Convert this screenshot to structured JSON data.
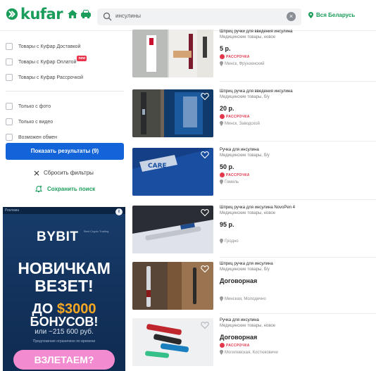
{
  "header": {
    "logo_text": "kufar",
    "search_query": "инсулины",
    "region_label": "Вся Беларусь"
  },
  "filters": {
    "items": [
      {
        "label": "Товары с Куфар Доставкой",
        "badge": ""
      },
      {
        "label": "Товары с Куфар Оплатой",
        "badge": "new"
      },
      {
        "label": "Товары с Куфар Рассрочкой",
        "badge": ""
      }
    ],
    "items2": [
      {
        "label": "Только с фото"
      },
      {
        "label": "Только с видео"
      },
      {
        "label": "Возможен обмен"
      }
    ],
    "show_button": "Показать результаты (9)",
    "reset_label": "Сбросить фильтры",
    "save_label": "Сохранить поиск"
  },
  "ad": {
    "tag": "Реклама",
    "brand": "BYBIT",
    "brand_sub": "Best Crypto Trading",
    "line1": "НОВИЧКАМ",
    "line2": "ВЕЗЕТ!",
    "line3_prefix": "ДО ",
    "line3_amount": "$3000",
    "line4": "БОНУСОВ!",
    "line5": "или ~215 600 руб.",
    "line6": "Предложение ограничено по времени",
    "cta": "ВЗЛЕТАЕМ?"
  },
  "listings": [
    {
      "title": "Шприц ручки для введения инсулина",
      "category": "Медицинские товары, новое",
      "price": "5 р.",
      "installment": "РАССРОЧКА",
      "location": "Минск, Фрунзенский"
    },
    {
      "title": "Шприц ручка для введения инсулина",
      "category": "Медицинские товары, б/у",
      "price": "20 р.",
      "installment": "РАССРОЧКА",
      "location": "Минск, Заводской"
    },
    {
      "title": "Ручка для инсулина",
      "category": "Медицинские товары, б/у",
      "price": "50 р.",
      "installment": "РАССРОЧКА",
      "location": "Гомель"
    },
    {
      "title": "Шприц ручка для инсулина NovoPen 4",
      "category": "Медицинские товары, новое",
      "price": "95 р.",
      "installment": "",
      "location": "Гродно"
    },
    {
      "title": "Шприц ручка для инсулина",
      "category": "Медицинские товары, б/у",
      "price": "Договорная",
      "installment": "",
      "location": "Минская, Молодечно"
    },
    {
      "title": "Ручка для инсулина",
      "category": "Медицинские товары, новое",
      "price": "Договорная",
      "installment": "РАССРОЧКА",
      "location": "Могилевская, Костюковичи"
    }
  ],
  "colors": {
    "brand_green": "#1a9d5a",
    "primary_blue": "#1264d8",
    "installment_red": "#e2384d"
  }
}
